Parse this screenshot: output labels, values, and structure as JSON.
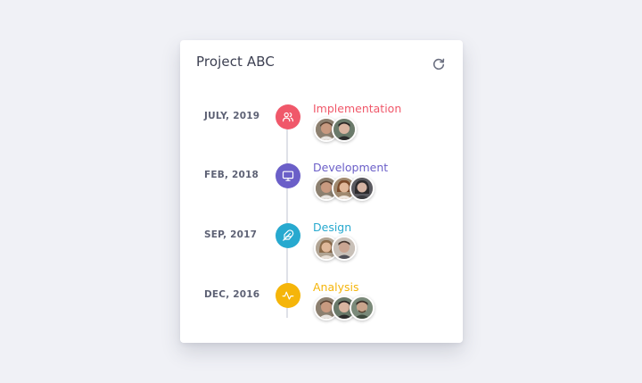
{
  "card": {
    "title": "Project ABC",
    "refresh_icon": "refresh-icon"
  },
  "timeline": [
    {
      "date": "JULY, 2019",
      "label": "Implementation",
      "color": "#f0586a",
      "icon": "users-icon",
      "avatars": [
        {
          "skin": "#c99a80",
          "hair": "#5a4030"
        },
        {
          "skin": "#d8b4a0",
          "hair": "#2a2624"
        }
      ]
    },
    {
      "date": "FEB, 2018",
      "label": "Development",
      "color": "#6b5fc8",
      "icon": "monitor-icon",
      "avatars": [
        {
          "skin": "#c99a80",
          "hair": "#5a4030"
        },
        {
          "skin": "#e0b89a",
          "hair": "#7a4a2a"
        },
        {
          "skin": "#d6b4a4",
          "hair": "#2c2a2c"
        }
      ]
    },
    {
      "date": "SEP, 2017",
      "label": "Design",
      "color": "#27a9cf",
      "icon": "feather-icon",
      "avatars": [
        {
          "skin": "#e0b89a",
          "hair": "#8a6a4a"
        },
        {
          "skin": "#caa592",
          "hair": "#4a3a32"
        }
      ]
    },
    {
      "date": "DEC, 2016",
      "label": "Analysis",
      "color": "#f5b50a",
      "icon": "activity-icon",
      "avatars": [
        {
          "skin": "#c99a80",
          "hair": "#5a4030"
        },
        {
          "skin": "#d8b4a0",
          "hair": "#2a2624"
        },
        {
          "skin": "#c8a48c",
          "hair": "#3a302a"
        }
      ]
    }
  ]
}
